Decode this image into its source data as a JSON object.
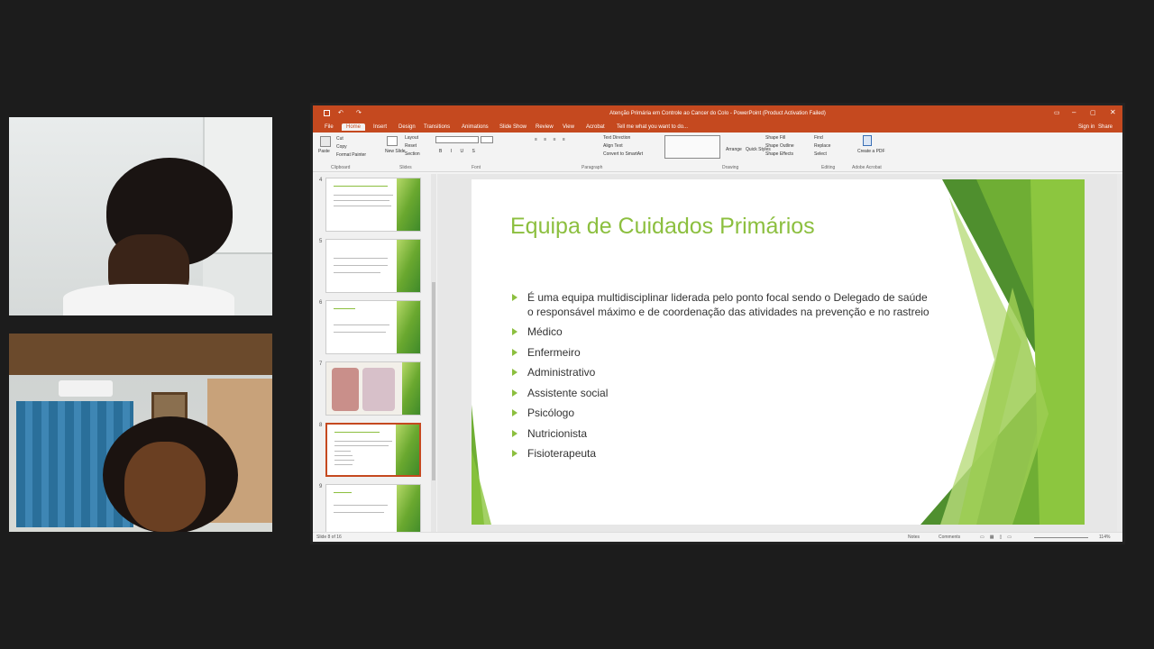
{
  "app": {
    "window_title": "Atenção Primária em Controle ao Cancer do Colo - PowerPoint (Product Activation Failed)",
    "sign_in": "Sign in",
    "share": "Share",
    "tell_me": "Tell me what you want to do..."
  },
  "tabs": [
    "File",
    "Home",
    "Insert",
    "Design",
    "Transitions",
    "Animations",
    "Slide Show",
    "Review",
    "View",
    "Acrobat"
  ],
  "ribbon": {
    "paste": "Paste",
    "cut": "Cut",
    "copy": "Copy",
    "format_painter": "Format Painter",
    "new_slide": "New Slide",
    "layout": "Layout",
    "reset": "Reset",
    "section": "Section",
    "text_direction": "Text Direction",
    "align_text": "Align Text",
    "convert_smartart": "Convert to SmartArt",
    "arrange": "Arrange",
    "quick_styles": "Quick Styles",
    "shape_fill": "Shape Fill",
    "shape_outline": "Shape Outline",
    "shape_effects": "Shape Effects",
    "find": "Find",
    "replace": "Replace",
    "select": "Select",
    "create_pdf": "Create a PDF",
    "groups": [
      "Clipboard",
      "Slides",
      "Font",
      "Paragraph",
      "Drawing",
      "Editing",
      "Adobe Acrobat"
    ]
  },
  "thumbnails": [
    {
      "num": "4"
    },
    {
      "num": "5"
    },
    {
      "num": "6"
    },
    {
      "num": "7"
    },
    {
      "num": "8",
      "selected": true
    },
    {
      "num": "9"
    }
  ],
  "slide": {
    "title": "Equipa de Cuidados Primários",
    "bullets": [
      "É uma equipa multidisciplinar liderada pelo ponto focal sendo o Delegado de saúde o responsável máximo e de coordenação das atividades na prevenção e no rastreio",
      "Médico",
      "Enfermeiro",
      "Administrativo",
      "Assistente social",
      "Psicólogo",
      "Nutricionista",
      "Fisioterapeuta"
    ],
    "accent_color": "#8cbf3f"
  },
  "status": {
    "slide_count": "Slide 8 of 16",
    "notes": "Notes",
    "comments": "Comments",
    "zoom": "114%"
  }
}
